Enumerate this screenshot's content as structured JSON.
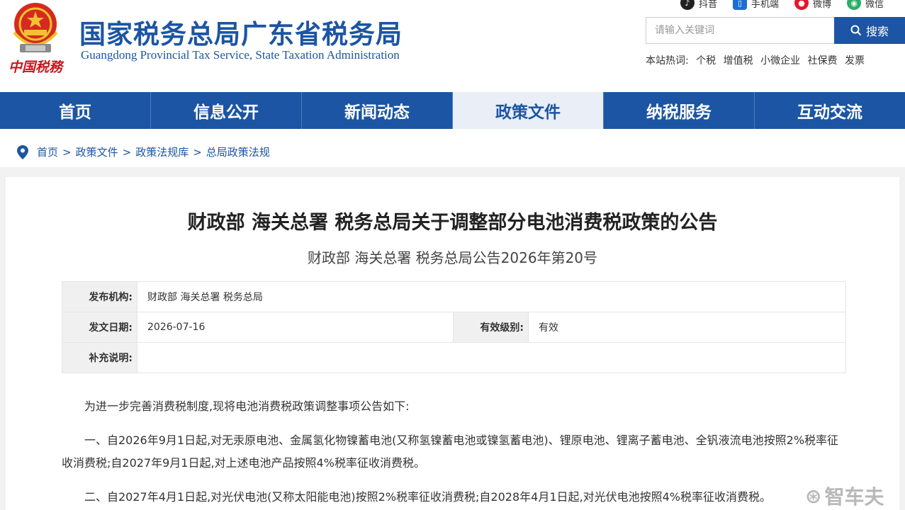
{
  "header": {
    "title": "国家税务总局广东省税务局",
    "subtitle": "Guangdong Provincial Tax Service, State Taxation Administration",
    "emblem_text": "中国税務",
    "social": [
      {
        "label": "抖音",
        "icon": "douyin-icon",
        "color": "#222222"
      },
      {
        "label": "手机端",
        "icon": "mobile-icon",
        "color": "#1c6fd0"
      },
      {
        "label": "微博",
        "icon": "weibo-icon",
        "color": "#e6162d"
      },
      {
        "label": "微信",
        "icon": "wechat-icon",
        "color": "#2aae67"
      }
    ],
    "search": {
      "placeholder": "请输入关键词",
      "button": "搜索"
    },
    "hot_label": "本站热词:",
    "hot_words": [
      "个税",
      "增值税",
      "小微企业",
      "社保费",
      "发票"
    ]
  },
  "nav": {
    "items": [
      "首页",
      "信息公开",
      "新闻动态",
      "政策文件",
      "纳税服务",
      "互动交流"
    ],
    "active": "政策文件"
  },
  "breadcrumb": [
    "首页",
    "政策文件",
    "政策法规库",
    "总局政策法规"
  ],
  "document": {
    "title": "财政部 海关总署 税务总局关于调整部分电池消费税政策的公告",
    "number": "财政部 海关总署 税务总局公告2026年第20号",
    "info": {
      "issuer_label": "发布机构:",
      "issuer": "财政部 海关总署 税务总局",
      "date_label": "发文日期:",
      "date": "2026-07-16",
      "level_label": "有效级别:",
      "level": "有效",
      "note_label": "补充说明:",
      "note": ""
    },
    "paragraphs": [
      "为进一步完善消费税制度,现将电池消费税政策调整事项公告如下:",
      "一、自2026年9月1日起,对无汞原电池、金属氢化物镍蓄电池(又称氢镍蓄电池或镍氢蓄电池)、锂原电池、锂离子蓄电池、全钒液流电池按照2%税率征收消费税;自2027年9月1日起,对上述电池产品按照4%税率征收消费税。",
      "二、自2027年4月1日起,对光伏电池(又称太阳能电池)按照2%税率征收消费税;自2028年4月1日起,对光伏电池按照4%税率征收消费税。"
    ]
  },
  "watermark": "智车夫",
  "colors": {
    "brand": "#1c55a3",
    "emblem_red": "#c8161d"
  }
}
